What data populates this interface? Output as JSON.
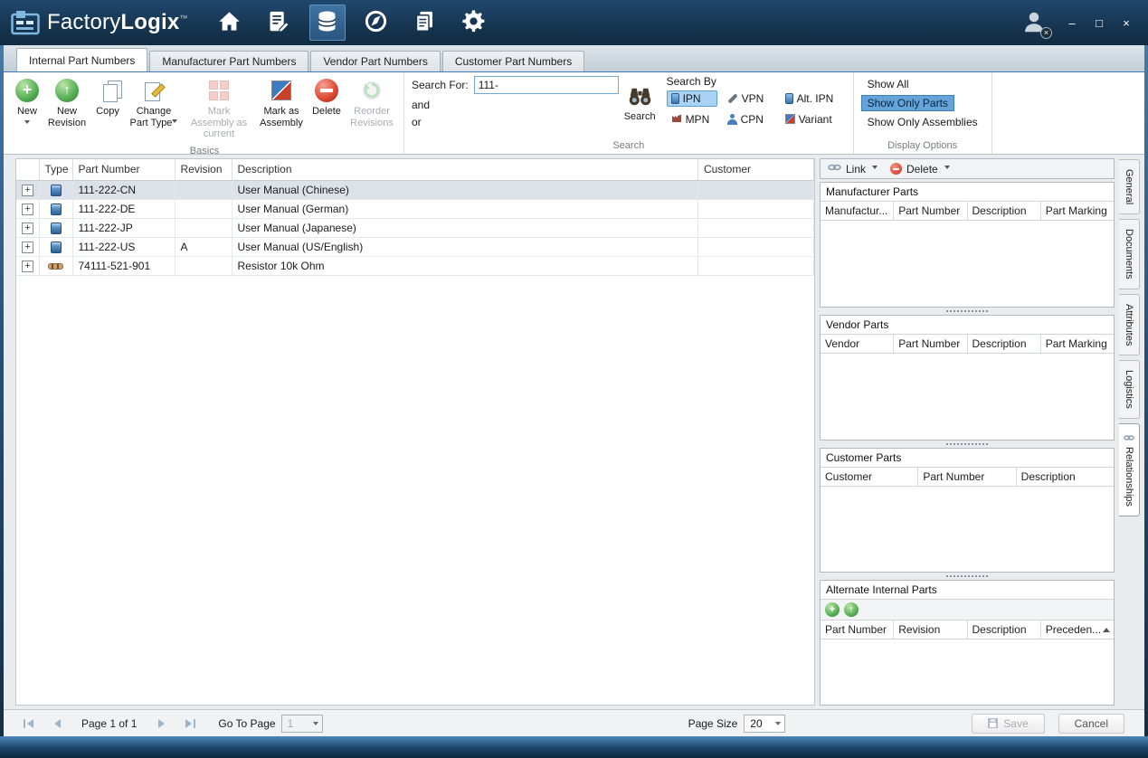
{
  "icons": {
    "minimize": "–",
    "maximize": "□",
    "close": "×",
    "plus": "+",
    "up_arrow": "↑"
  },
  "titlebar": {
    "brand_a": "Factory",
    "brand_b": "Logix",
    "tm": "™"
  },
  "tabs": {
    "internal": "Internal Part Numbers",
    "manufacturer": "Manufacturer Part Numbers",
    "vendor": "Vendor Part Numbers",
    "customer": "Customer Part Numbers"
  },
  "ribbon": {
    "groups": {
      "basics": "Basics",
      "search": "Search",
      "display": "Display Options"
    },
    "buttons": {
      "new": "New",
      "new_revision": "New Revision",
      "copy": "Copy",
      "change_part_type": "Change Part Type",
      "mark_assembly_current": "Mark Assembly as current",
      "mark_as_assembly": "Mark as Assembly",
      "delete": "Delete",
      "reorder_revisions": "Reorder Revisions"
    },
    "search": {
      "search_for": "Search For:",
      "value": "111-",
      "and": "and",
      "or": "or",
      "search_btn": "Search",
      "search_by": "Search By",
      "toggles": {
        "ipn": "IPN",
        "vpn": "VPN",
        "alt_ipn": "Alt. IPN",
        "mpn": "MPN",
        "cpn": "CPN",
        "variant": "Variant"
      }
    },
    "display": {
      "show_all": "Show All",
      "show_only_parts": "Show Only Parts",
      "show_only_assemblies": "Show Only Assemblies"
    }
  },
  "table": {
    "headers": {
      "type": "Type",
      "part_number": "Part Number",
      "revision": "Revision",
      "description": "Description",
      "customer": "Customer"
    },
    "rows": [
      {
        "part_number": "111-222-CN",
        "revision": "",
        "description": "User Manual (Chinese)",
        "customer": ""
      },
      {
        "part_number": "111-222-DE",
        "revision": "",
        "description": "User Manual (German)",
        "customer": ""
      },
      {
        "part_number": "111-222-JP",
        "revision": "",
        "description": "User Manual (Japanese)",
        "customer": ""
      },
      {
        "part_number": "111-222-US",
        "revision": "A",
        "description": "User Manual (US/English)",
        "customer": ""
      },
      {
        "part_number": "74111-521-901",
        "revision": "",
        "description": "Resistor 10k Ohm",
        "customer": ""
      }
    ]
  },
  "panel": {
    "link_label": "Link",
    "delete_label": "Delete",
    "manufacturer_parts": {
      "title": "Manufacturer Parts",
      "col1": "Manufactur...",
      "col2": "Part Number",
      "col3": "Description",
      "col4": "Part Marking"
    },
    "vendor_parts": {
      "title": "Vendor Parts",
      "col1": "Vendor",
      "col2": "Part Number",
      "col3": "Description",
      "col4": "Part Marking"
    },
    "customer_parts": {
      "title": "Customer Parts",
      "col1": "Customer",
      "col2": "Part Number",
      "col3": "Description"
    },
    "alternate_parts": {
      "title": "Alternate Internal Parts",
      "col1": "Part Number",
      "col2": "Revision",
      "col3": "Description",
      "col4": "Preceden..."
    }
  },
  "side_tabs": {
    "general": "General",
    "documents": "Documents",
    "attributes": "Attributes",
    "logistics": "Logistics",
    "relationships": "Relationships"
  },
  "footer": {
    "page_info": "Page 1 of 1",
    "goto_label": "Go To Page",
    "goto_value": "1",
    "page_size_label": "Page Size",
    "page_size_value": "20",
    "save": "Save",
    "cancel": "Cancel"
  }
}
